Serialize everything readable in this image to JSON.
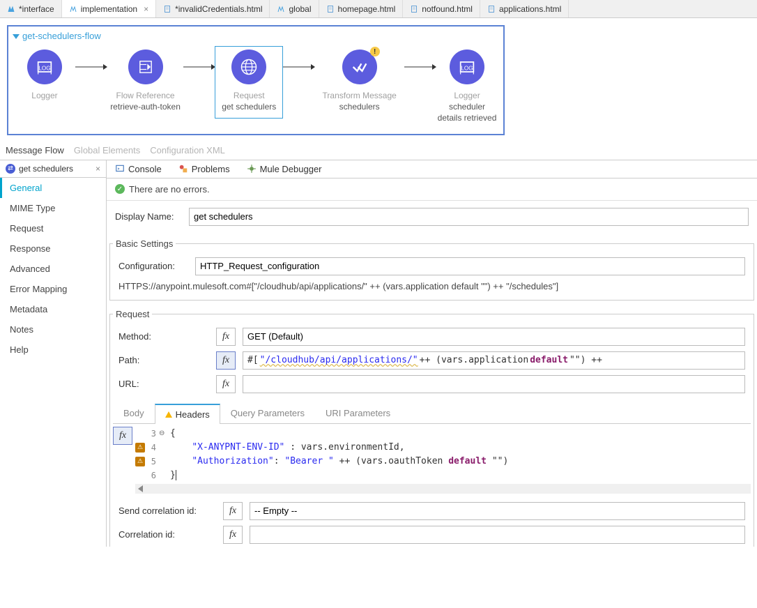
{
  "tabs": [
    {
      "label": "*interface",
      "icon": "mule"
    },
    {
      "label": "implementation",
      "icon": "mule",
      "closable": true,
      "active": true
    },
    {
      "label": "*invalidCredentials.html",
      "icon": "file"
    },
    {
      "label": "global",
      "icon": "mule"
    },
    {
      "label": "homepage.html",
      "icon": "file"
    },
    {
      "label": "notfound.html",
      "icon": "file"
    },
    {
      "label": "applications.html",
      "icon": "file"
    }
  ],
  "flow": {
    "title": "get-schedulers-flow",
    "nodes": [
      {
        "type": "Logger",
        "name": ""
      },
      {
        "type": "Flow Reference",
        "name": "retrieve-auth-token"
      },
      {
        "type": "Request",
        "name": "get schedulers",
        "selected": true
      },
      {
        "type": "Transform Message",
        "name": "schedulers",
        "warn": true
      },
      {
        "type": "Logger",
        "name": "scheduler details retrieved"
      }
    ]
  },
  "subtabs": {
    "active": "Message Flow",
    "others": [
      "Global Elements",
      "Configuration XML"
    ]
  },
  "component_tab": "get schedulers",
  "sidemenu": [
    "General",
    "MIME Type",
    "Request",
    "Response",
    "Advanced",
    "Error Mapping",
    "Metadata",
    "Notes",
    "Help"
  ],
  "sidemenu_active": "General",
  "tools": [
    "Console",
    "Problems",
    "Mule Debugger"
  ],
  "status_text": "There are no errors.",
  "display_name_label": "Display Name:",
  "display_name_value": "get schedulers",
  "basic_settings_legend": "Basic Settings",
  "configuration_label": "Configuration:",
  "configuration_value": "HTTP_Request_configuration",
  "url_preview": "HTTPS://anypoint.mulesoft.com#[\"/cloudhub/api/applications/\" ++ (vars.application default \"\") ++ \"/schedules\"]",
  "request_legend": "Request",
  "method_label": "Method:",
  "method_value": "GET (Default)",
  "path_label": "Path:",
  "path_prefix": "#[ ",
  "path_str1": "\"/cloudhub/api/applications/\"",
  "path_mid": " ++ (vars.application ",
  "path_kw": "default",
  "path_end": " \"\") ++",
  "url_label": "URL:",
  "inner_tabs": [
    "Body",
    "Headers",
    "Query Parameters",
    "URI Parameters"
  ],
  "inner_active": "Headers",
  "code_line3": "{",
  "code_l4_key": "\"X-ANYPNT-ENV-ID\"",
  "code_l4_rest": " : vars.environmentId,",
  "code_l5_key": "\"Authorization\"",
  "code_l5_b": "\"Bearer \"",
  "code_l5_mid": " ++ (vars.oauthToken ",
  "code_l5_kw": "default",
  "code_l5_end": " \"\")",
  "code_line6": "}",
  "send_corr_label": "Send correlation id:",
  "send_corr_value": "-- Empty --",
  "corr_label": "Correlation id:"
}
